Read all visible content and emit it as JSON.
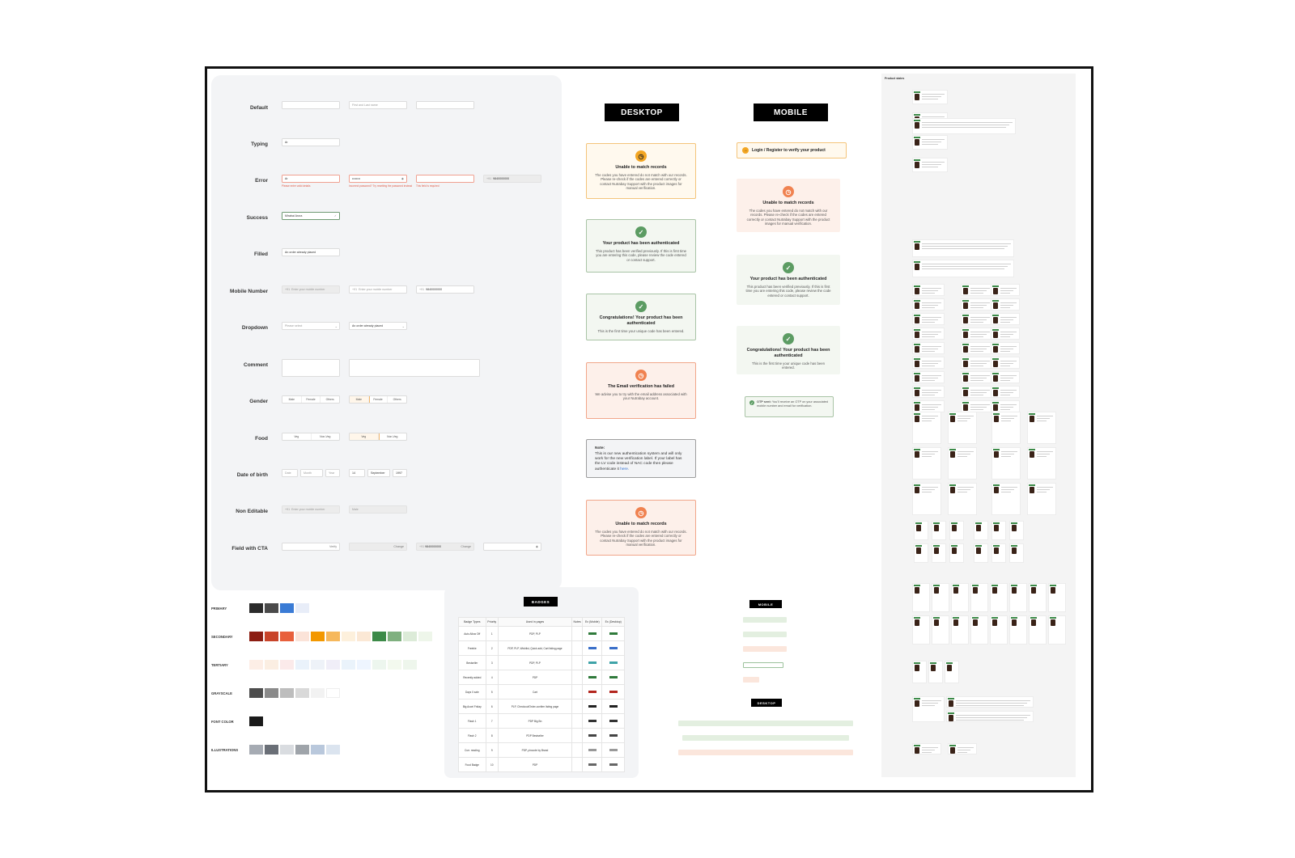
{
  "form_fields": {
    "rows": [
      "Default",
      "Typing",
      "Error",
      "Success",
      "Filled",
      "Mobile Number",
      "Dropdown",
      "Comment",
      "Gender",
      "Food",
      "Date of birth",
      "Non Editable",
      "Field with CTA"
    ],
    "placeholder_name": "First and Last name",
    "typing_value": "Ar",
    "error_invalid": "Please enter valid details",
    "error_email": "Incorrect password? Try resetting the password instead",
    "error_required": "This field is required",
    "success_value": "Mirabai Arora",
    "filled_value": "An order already placed",
    "mobile_code": "+91",
    "mobile_placeholder": "Enter your mobile number",
    "mobile_value": "9840000000",
    "dropdown_placeholder": "Please select",
    "dropdown_value": "An order already placed",
    "gender": [
      "Male",
      "Female",
      "Others"
    ],
    "food": [
      "Veg",
      "Non-Veg"
    ],
    "dob_default": [
      "Date",
      "Month",
      "Year"
    ],
    "dob_filled": [
      "14",
      "September",
      "1997"
    ],
    "nonedit_value": "Male",
    "cta_change": "Change",
    "cta_verify": "Verify"
  },
  "headers": {
    "desktop": "DESKTOP",
    "mobile": "MOBILE"
  },
  "desktop_cards": [
    {
      "title": "Unable to match records",
      "body": "The codes you have entered do not match with our records. Please re-check if the codes are entered correctly or contact Nutrabay Support with the product images for manual verification."
    },
    {
      "title": "Your product has been authenticated",
      "body": "This product has been verified previously. If this is first time you are entering this code, please review the code entered or contact support."
    },
    {
      "title": "Congratulations! Your product has been authenticated",
      "body": "This is the first time your unique code has been entered."
    },
    {
      "title": "The Email verification has failed",
      "body": "We advise you to try with the email address associated with your Nutrabay account."
    },
    {
      "title": "Note:",
      "body": "This is our new authentication system and will only work for the new verification label. If your label has the LV code instead of NAC code then please authenticate it",
      "link": "here."
    },
    {
      "title": "Unable to match records",
      "body": "The codes you have entered do not match with our records. Please re-check if the codes are entered correctly or contact Nutrabay Support with the product images for manual verification."
    }
  ],
  "mobile_cards": {
    "login_banner": "Login / Register to verify your product",
    "items": [
      {
        "title": "Unable to match records",
        "body": "The codes you have entered do not match with our records. Please re-check if the codes are entered correctly or contact Nutrabay Support with the product images for manual verification."
      },
      {
        "title": "Your product has been authenticated",
        "body": "This product has been verified previously. If this is first time you are entering this code, please review the code entered or contact support."
      },
      {
        "title": "Congratulations! Your product has been authenticated",
        "body": "This is the first time your unique code has been entered."
      }
    ],
    "otp": {
      "bold": "OTP sent:",
      "rest": "You'll receive an OTP on your associated mobile number and email for verification."
    }
  },
  "palette": {
    "rows": [
      "PRIMARY",
      "SECONDARY",
      "TERTIARY",
      "GRAYSCALE",
      "FONT COLOR",
      "ILLUSTRATIONS"
    ],
    "primary": [
      "#2b2b2b",
      "#4a4a4a",
      "#3a7bd5",
      "#e8edf8"
    ],
    "secondary": [
      "#8c1d12",
      "#c8442a",
      "#e8603c",
      "#fbe3d8",
      "#f39800",
      "#f6b85c",
      "#fdf0dc",
      "#fbe8d5",
      "#3c8a48",
      "#7fb07f",
      "#dcebd8",
      "#eef6ea"
    ],
    "tertiary": [
      "#fdeee6",
      "#fbeee2",
      "#fbeaea",
      "#eaf2fb",
      "#eef2f8",
      "#f0eef8",
      "#eaf3fb",
      "#eef5ff",
      "#edf6ee",
      "#f3f9ee",
      "#eef6ec"
    ],
    "grayscale": [
      "#4d4d4d",
      "#8a8a8a",
      "#bdbdbd",
      "#d9d9d9",
      "#f2f2f2",
      "#ffffff"
    ],
    "font": [
      "#1a1a1a"
    ],
    "illustrations": [
      "#a6abb3",
      "#6a6f77",
      "#d9dce0",
      "#9fa4aa",
      "#b9c8dc",
      "#dbe4ef"
    ]
  },
  "badges": {
    "title": "BADGES",
    "columns": [
      "Badge Types",
      "Priority",
      "Used in pages",
      "Notes",
      "Ex (Mobile)",
      "Ex (Desktop)"
    ],
    "rows": [
      [
        "Auto Allow Off",
        "1",
        "PDP, PLP"
      ],
      [
        "Freebie",
        "2",
        "PDP, PLP, Wishlist, Quick add, Cart listing page"
      ],
      [
        "Bestseller",
        "3",
        "PDP, PLP"
      ],
      [
        "Recently added",
        "4",
        "PDP"
      ],
      [
        "Days 0 sale",
        "5",
        "Cart"
      ],
      [
        "Big Accel Friday",
        "6",
        "PLP, Checkout/Order-confirm listing page"
      ],
      [
        "Flash 1",
        "7",
        "PDP Big Bn"
      ],
      [
        "Flash 2",
        "8",
        "PDP Bestseller"
      ],
      [
        "Curr. reading",
        "9",
        "PDP, pincode by Brand"
      ],
      [
        "Food Badge",
        "10",
        "PDP"
      ]
    ]
  },
  "mini_headers": {
    "mobile": "MOBILE",
    "desktop": "DESKTOP"
  },
  "product_states": {
    "title": "Product states"
  }
}
